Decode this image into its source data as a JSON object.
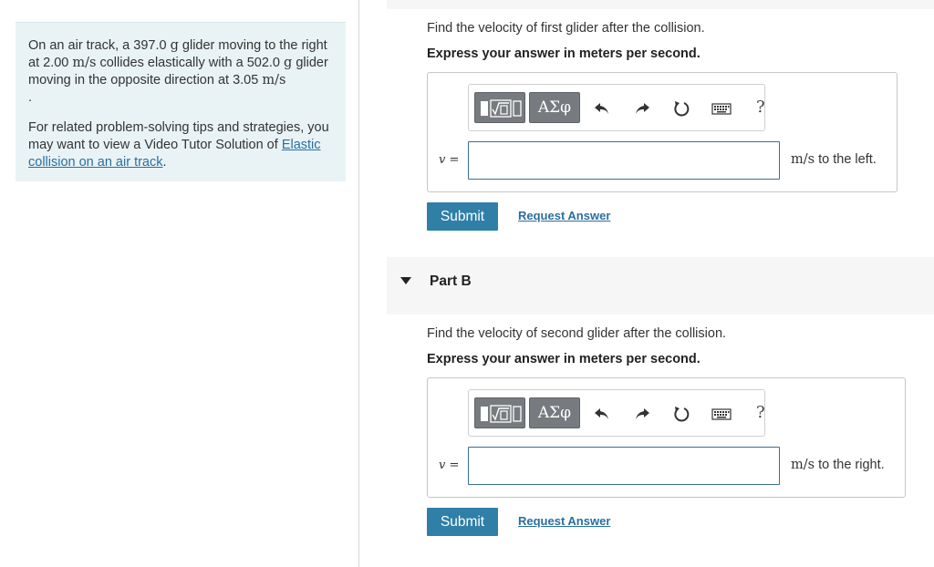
{
  "problem": {
    "text_1": "On an air track, a ",
    "mass_1": "397.0",
    "g_1": "g",
    "text_2": " glider moving to the right at ",
    "speed_1": "2.00",
    "unit_1": "m/s",
    "text_3": " collides elastically with a ",
    "mass_2": "502.0",
    "g_2": "g",
    "text_4": " glider moving in the opposite direction at ",
    "speed_2": "3.05",
    "unit_2": "m/s",
    "text_5": ".",
    "tips_prefix": "For related problem-solving tips and strategies, you may want to view a Video Tutor Solution of ",
    "tips_link": "Elastic collision on an air track",
    "tips_suffix": "."
  },
  "toolbar": {
    "greek_label": "ΑΣφ",
    "help_label": "?",
    "icons": [
      "templates-icon",
      "greek-letters-icon",
      "undo-icon",
      "redo-icon",
      "reset-icon",
      "keyboard-icon",
      "help-icon"
    ]
  },
  "part_a": {
    "prompt": "Find the velocity of first glider after the collision.",
    "instruction": "Express your answer in meters per second.",
    "variable": "v =",
    "input_value": "",
    "unit_math": "m/s",
    "unit_text": " to the left.",
    "submit_label": "Submit",
    "request_label": "Request Answer"
  },
  "part_b": {
    "header": "Part B",
    "prompt": "Find the velocity of second glider after the collision.",
    "instruction": "Express your answer in meters per second.",
    "variable": "v =",
    "input_value": "",
    "unit_math": "m/s",
    "unit_text": " to the right.",
    "submit_label": "Submit",
    "request_label": "Request Answer"
  },
  "colors": {
    "panel_bg": "#e9f3f6",
    "accent": "#2f7fa7",
    "link": "#2a6f9e",
    "toolbar_button": "#777b7f"
  }
}
